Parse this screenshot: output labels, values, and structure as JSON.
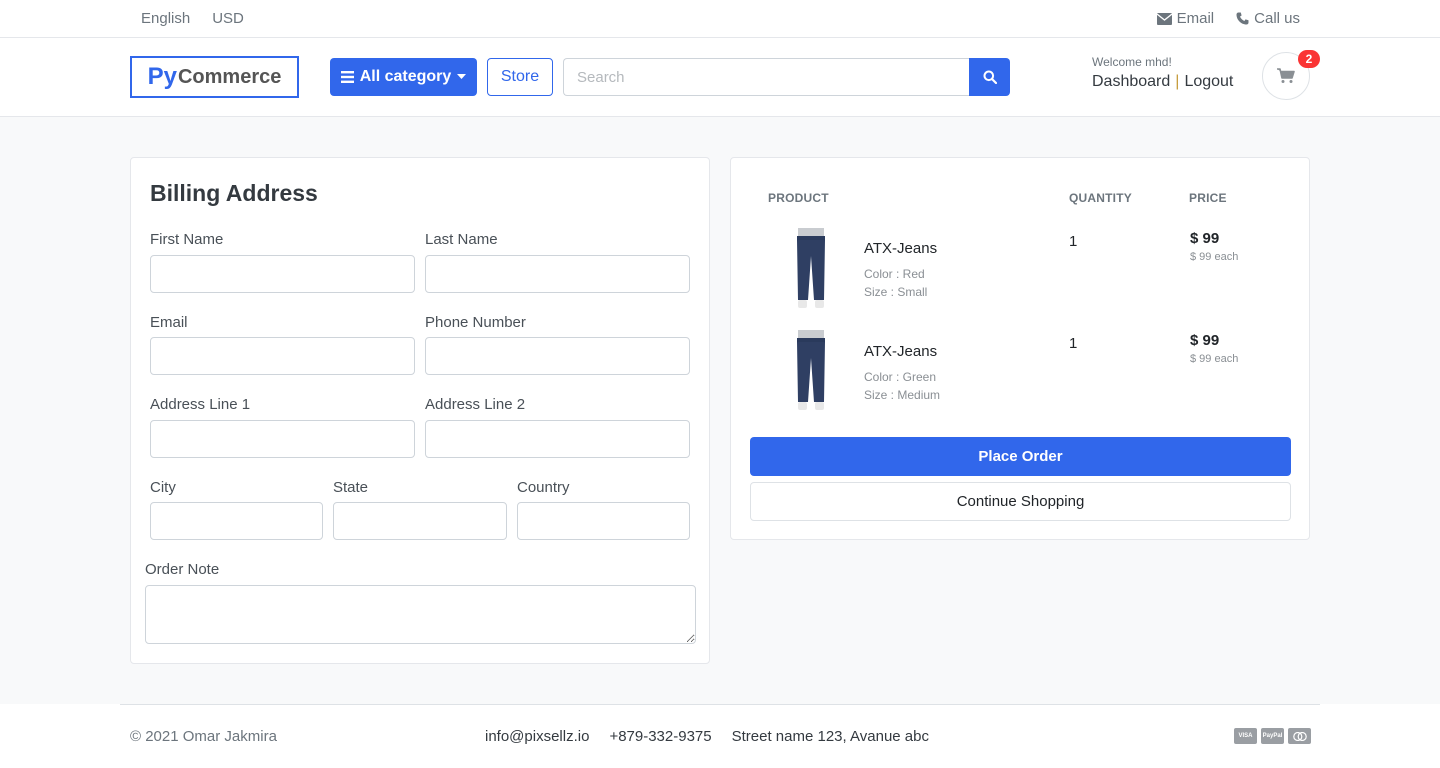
{
  "topbar": {
    "language": "English",
    "currency": "USD",
    "email_label": "Email",
    "call_label": "Call us"
  },
  "header": {
    "logo_py": "Py",
    "logo_rest": "Commerce",
    "category_label": "All category",
    "store_label": "Store",
    "search_placeholder": "Search",
    "welcome": "Welcome mhd!",
    "dashboard_label": "Dashboard",
    "separator": "|",
    "logout_label": "Logout",
    "cart_count": "2"
  },
  "billing": {
    "title": "Billing Address",
    "first_name_label": "First Name",
    "last_name_label": "Last Name",
    "email_label": "Email",
    "phone_label": "Phone Number",
    "address1_label": "Address Line 1",
    "address2_label": "Address Line 2",
    "city_label": "City",
    "state_label": "State",
    "country_label": "Country",
    "note_label": "Order Note"
  },
  "order": {
    "col_product": "PRODUCT",
    "col_quantity": "QUANTITY",
    "col_price": "PRICE",
    "items": [
      {
        "name": "ATX-Jeans",
        "color": "Color : Red",
        "size": "Size : Small",
        "quantity": "1",
        "price": "$ 99",
        "each": "$ 99 each"
      },
      {
        "name": "ATX-Jeans",
        "color": "Color : Green",
        "size": "Size : Medium",
        "quantity": "1",
        "price": "$ 99",
        "each": "$ 99 each"
      }
    ],
    "place_order_label": "Place Order",
    "continue_label": "Continue Shopping"
  },
  "footer": {
    "copyright": "© 2021 Omar Jakmira",
    "email": "info@pixsellz.io",
    "phone": "+879-332-9375",
    "address": "Street name 123, Avanue abc",
    "payments": [
      "visa-icon",
      "paypal-icon",
      "mastercard-icon"
    ]
  },
  "colors": {
    "primary": "#3167eb",
    "badge": "#fa3434",
    "background": "#f8f9fa"
  }
}
